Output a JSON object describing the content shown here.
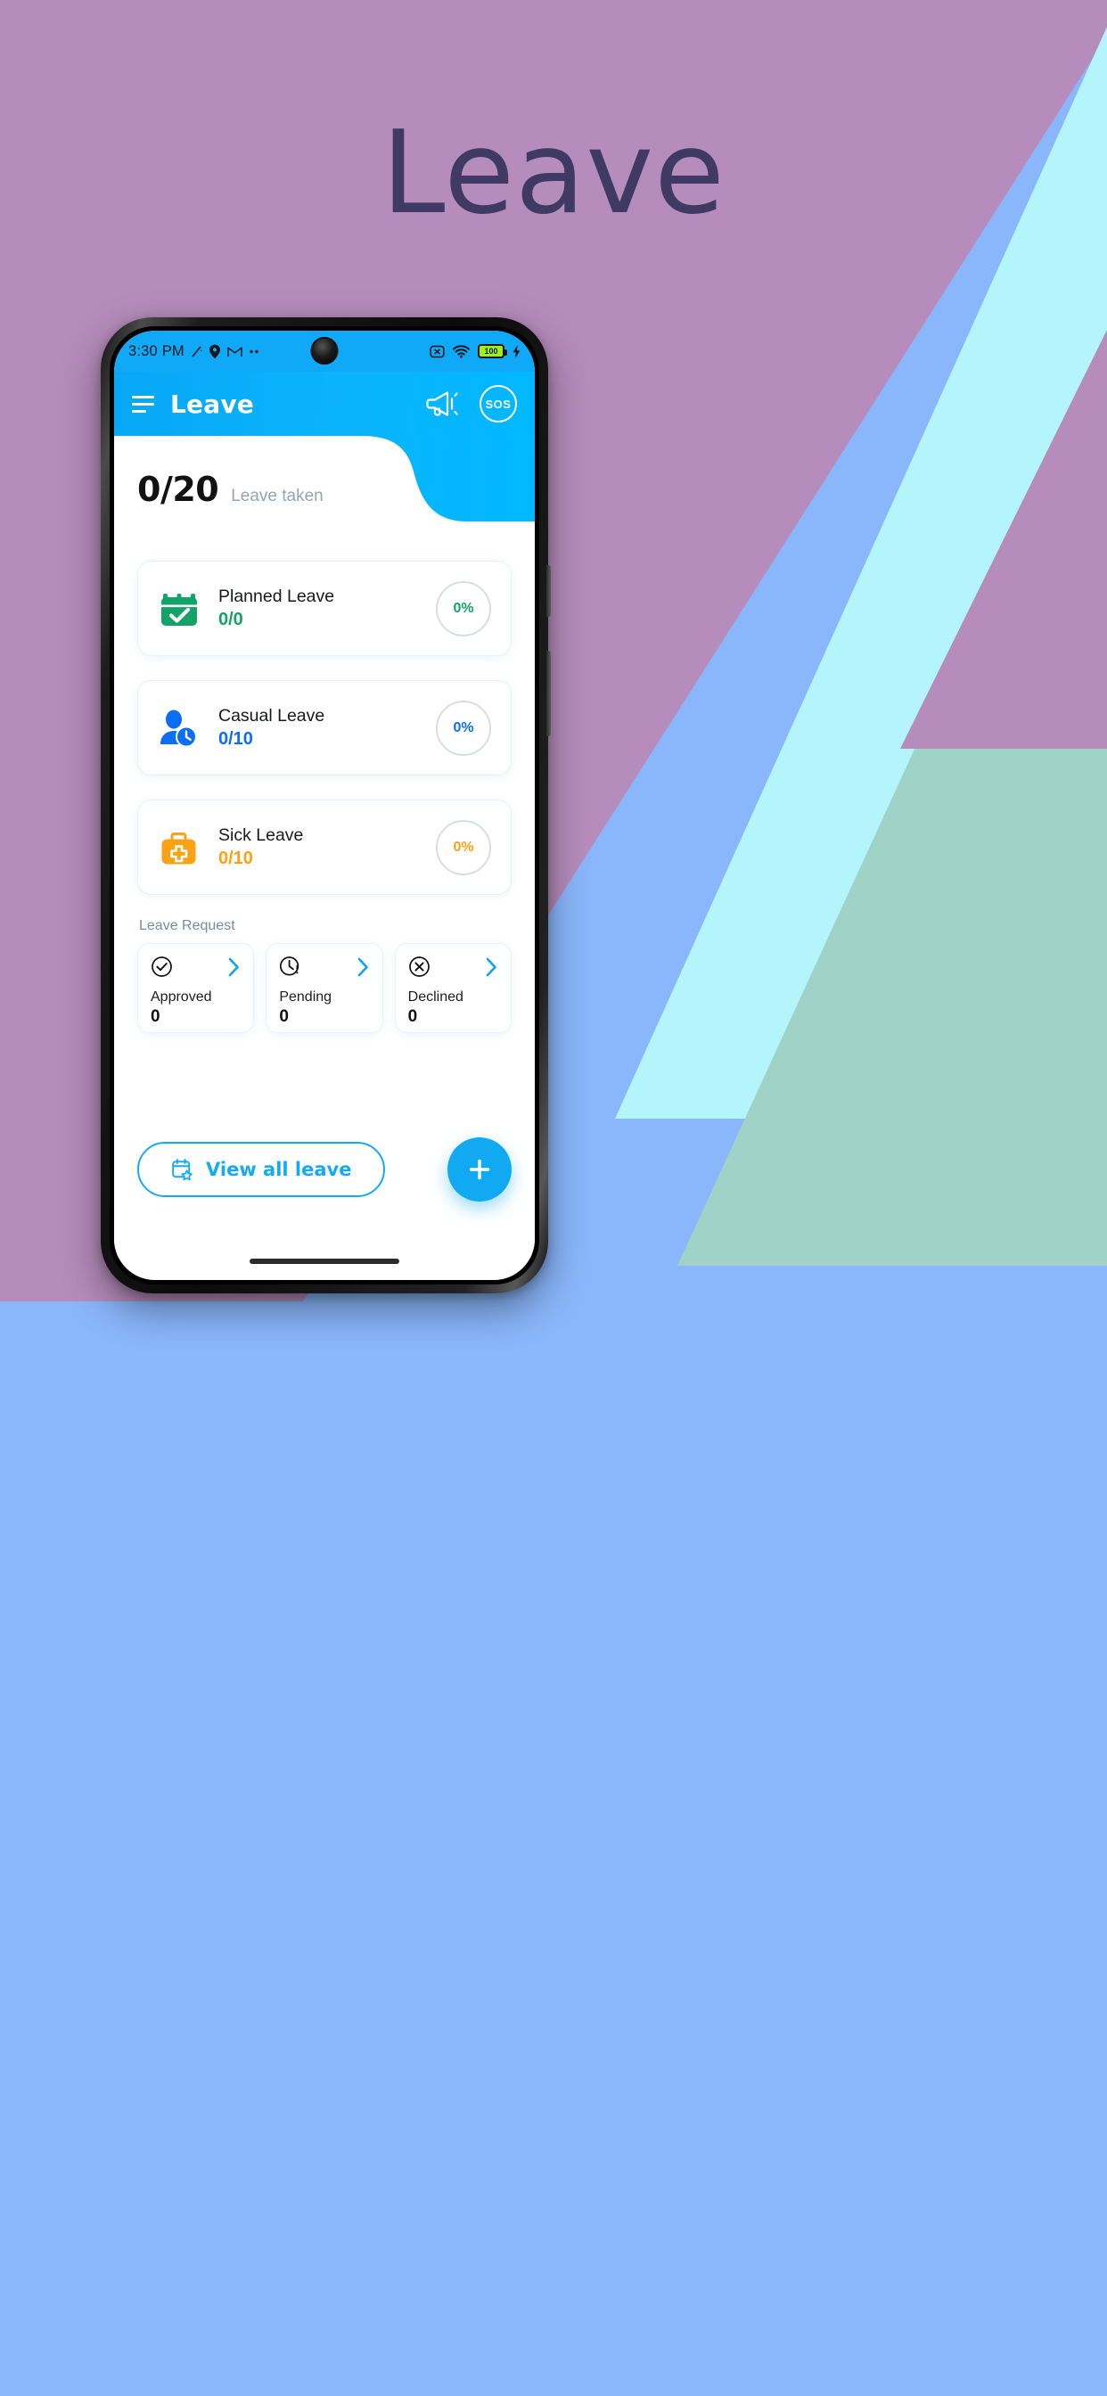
{
  "poster": {
    "title": "Leave",
    "title_color": "#3e3a63",
    "background_colors": {
      "purple": "#b58cbb",
      "cyan": "#b4f4fb",
      "teal": "#9fd3c7",
      "blue": "#8ab6fb"
    }
  },
  "status_bar": {
    "time": "3:30 PM",
    "left_icons": [
      "signal-slash-icon",
      "location-pin-icon",
      "gmail-icon",
      "more-dots-icon"
    ],
    "right_icons": [
      "vibrate-off-icon",
      "wifi-icon",
      "battery-icon",
      "charging-bolt-icon"
    ],
    "battery_level": "100"
  },
  "app_bar": {
    "menu_icon": "hamburger-menu-icon",
    "title": "Leave",
    "announce_icon": "megaphone-icon",
    "sos_label": "SOS"
  },
  "hero": {
    "count": "0/20",
    "label": "Leave taken"
  },
  "leave_cards": [
    {
      "icon": "calendar-check-icon",
      "title": "Planned Leave",
      "count": "0/0",
      "percent": "0%",
      "color": "#13a368"
    },
    {
      "icon": "person-clock-icon",
      "title": "Casual Leave",
      "count": "0/10",
      "percent": "0%",
      "color": "#0b6ef5"
    },
    {
      "icon": "medical-bag-icon",
      "title": "Sick Leave",
      "count": "0/10",
      "percent": "0%",
      "color": "#f9a215"
    }
  ],
  "leave_request": {
    "section_label": "Leave Request",
    "tiles": [
      {
        "icon": "check-circle-icon",
        "label": "Approved",
        "count": "0",
        "chevron": "chevron-right-icon"
      },
      {
        "icon": "clock-alert-icon",
        "label": "Pending",
        "count": "0",
        "chevron": "chevron-right-icon"
      },
      {
        "icon": "x-circle-icon",
        "label": "Declined",
        "count": "0",
        "chevron": "chevron-right-icon"
      }
    ]
  },
  "footer": {
    "view_all_icon": "calendar-star-icon",
    "view_all_label": "View all leave",
    "fab_icon": "plus-icon"
  }
}
